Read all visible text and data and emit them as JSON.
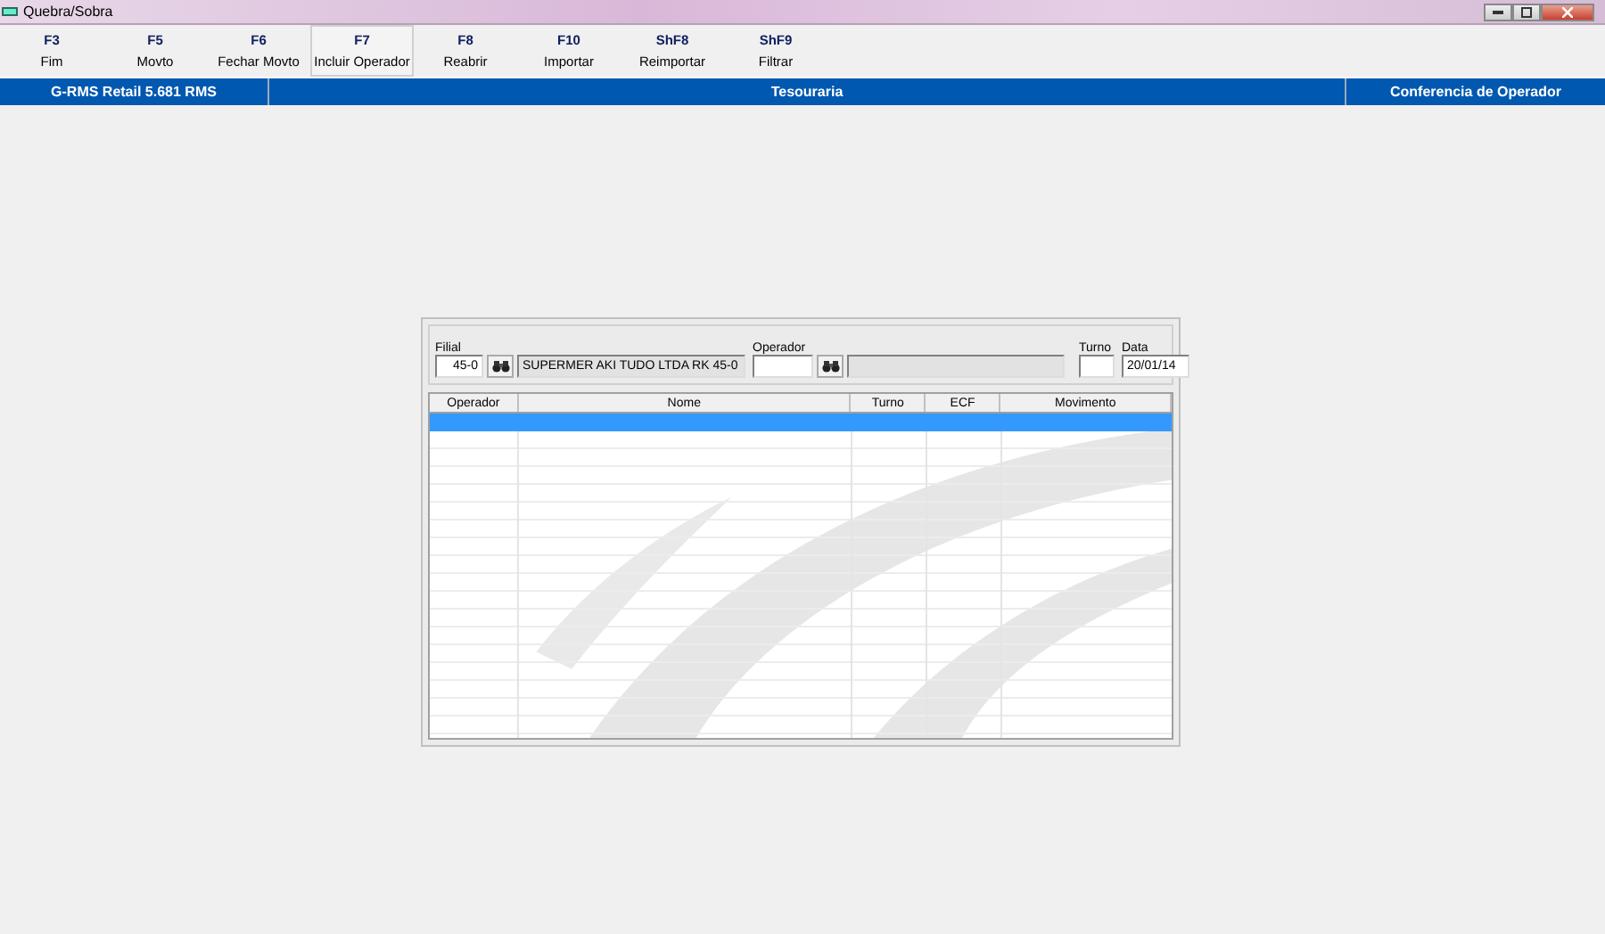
{
  "window": {
    "title": "Quebra/Sobra"
  },
  "toolbar": [
    {
      "key": "F3",
      "label": "Fim",
      "selected": false
    },
    {
      "key": "F5",
      "label": "Movto",
      "selected": false
    },
    {
      "key": "F6",
      "label": "Fechar Movto",
      "selected": false
    },
    {
      "key": "F7",
      "label": "Incluir Operador",
      "selected": true
    },
    {
      "key": "F8",
      "label": "Reabrir",
      "selected": false
    },
    {
      "key": "F10",
      "label": "Importar",
      "selected": false
    },
    {
      "key": "ShF8",
      "label": "Reimportar",
      "selected": false
    },
    {
      "key": "ShF9",
      "label": "Filtrar",
      "selected": false
    }
  ],
  "header_bar": {
    "system": "G-RMS Retail 5.681 RMS",
    "module": "Tesouraria",
    "screen": "Conferencia de Operador"
  },
  "filter": {
    "filial": {
      "label": "Filial",
      "value": "45-0",
      "description": "SUPERMER AKI TUDO LTDA RK 45-0"
    },
    "operador": {
      "label": "Operador"
    },
    "turno": {
      "label": "Turno"
    },
    "data": {
      "label": "Data",
      "value": "20/01/14"
    }
  },
  "table": {
    "columns": [
      "Operador",
      "Nome",
      "Turno",
      "ECF",
      "Movimento"
    ],
    "rows": [
      {
        "selected": true
      }
    ]
  }
}
